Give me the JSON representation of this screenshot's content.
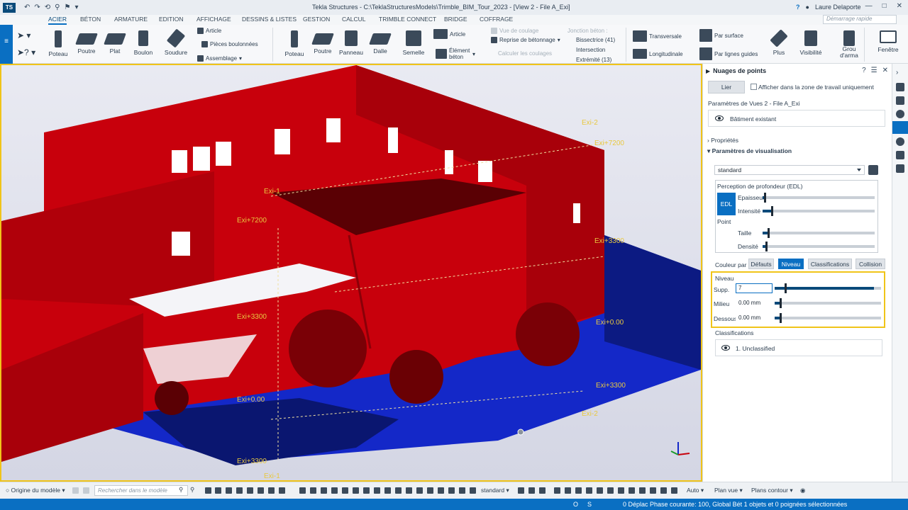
{
  "window": {
    "title": "Tekla Structures - C:\\TeklaStructuresModels\\Trimble_BIM_Tour_2023  - [View 2 - File A_Exi]",
    "logo": "TS",
    "user": "Laure Delaporte",
    "controls": [
      "—",
      "□",
      "✕"
    ],
    "quick_access": [
      "↶",
      "↷",
      "⟲",
      "⚲",
      "⚑",
      "▾"
    ]
  },
  "menu": {
    "tabs": [
      "ACIER",
      "BÉTON",
      "ARMATURE",
      "EDITION",
      "AFFICHAGE",
      "DESSINS & LISTES",
      "GESTION",
      "CALCUL",
      "TRIMBLE CONNECT",
      "BRIDGE",
      "COFFRAGE"
    ],
    "active": "ACIER",
    "search_placeholder": "Démarrage rapide"
  },
  "ribbon": {
    "steel": [
      "Poteau",
      "Poutre",
      "Plat",
      "Boulon",
      "Soudure"
    ],
    "steel_small": [
      "Article",
      "Pièces boulonnées",
      "Assemblage"
    ],
    "concrete": [
      "Poteau",
      "Poutre",
      "Panneau",
      "Dalle",
      "Semelle"
    ],
    "concrete_small": [
      "Article",
      "Élément béton"
    ],
    "pour": [
      "Vue de coulage",
      "Reprise de bétonnage",
      "Calculer les coulages"
    ],
    "joint_header": "Jonction béton :",
    "joint": [
      "Bissectrice (41)",
      "Intersection",
      "Extrémité (13)"
    ],
    "rebar": [
      "Transversale",
      "Longitudinale",
      "Par surface",
      "Par lignes guides"
    ],
    "right": [
      "Plus",
      "Visibilité",
      "Grou d'arma",
      "Fenêtre"
    ]
  },
  "viewport": {
    "labels": [
      "Exi-2",
      "Exi+7200",
      "Exi-1",
      "Exi+7200",
      "Exi+3300",
      "Exi+3300",
      "Exi+0.00",
      "Exi+0.00",
      "Exi+3300",
      "Exi-2",
      "Exi+3300",
      "Exi-1"
    ],
    "colors": {
      "red": "#c8000c",
      "red_dark": "#8a0008",
      "blue": "#1428c8",
      "blue_dark": "#0a1670",
      "highlight": "#f0c419"
    }
  },
  "panel": {
    "title": "Nuages de points",
    "link_button": "Lier",
    "only_workspace_label": "Afficher dans la zone de travail uniquement",
    "params_label": "Paramètres de Vues 2 - File A_Exi",
    "cloud_name": "Bâtiment existant",
    "properties_label": "Propriétés",
    "display_params_label": "Paramètres de visualisation",
    "preset": "standard",
    "edl_title": "Perception de profondeur (EDL)",
    "edl_badge": "EDL",
    "edl_thickness": "Epaisseur",
    "edl_intensity": "Intensité",
    "point_title": "Point",
    "point_size": "Taille",
    "point_density": "Densité",
    "color_by_label": "Couleur par",
    "color_by_options": [
      "Défauts",
      "Niveau",
      "Classifications",
      "Collision"
    ],
    "color_by_active": "Niveau",
    "level": {
      "title": "Niveau",
      "top_label": "Supp.",
      "top_value": "7",
      "middle_label": "Milieu",
      "middle_value": "0.00 mm",
      "bottom_label": "Dessous",
      "bottom_value": "0.00 mm"
    },
    "classifications_title": "Classifications",
    "classification_item": "1. Unclassified",
    "sliders": {
      "thickness": 0.02,
      "intensity": 0.08,
      "size": 0.05,
      "density": 0.03,
      "top": 0.93,
      "middle": 0.05,
      "bottom": 0.05
    }
  },
  "bottom": {
    "origin": "Origine du modèle",
    "search_placeholder": "Rechercher dans le modèle",
    "view_preset": "standard",
    "auto": "Auto",
    "view_plane": "Plan vue",
    "outline_plane": "Plans contour"
  },
  "status": {
    "o": "O",
    "s": "S",
    "message": "0  Déplac Phase courante: 100, Global Bét 1 objets et 0 poignées sélectionnées"
  }
}
